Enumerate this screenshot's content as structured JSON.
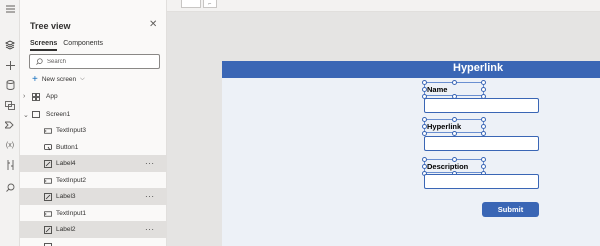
{
  "tree_panel": {
    "title": "Tree view",
    "tabs": [
      "Screens",
      "Components"
    ],
    "search_placeholder": "Search",
    "new_screen_label": "New screen",
    "items": [
      {
        "label": "App",
        "icon": "app-icon"
      },
      {
        "label": "Screen1",
        "icon": "screen-icon"
      },
      {
        "label": "TextInput3",
        "icon": "textinput-icon"
      },
      {
        "label": "Button1",
        "icon": "button-icon"
      },
      {
        "label": "Label4",
        "icon": "label-icon",
        "selected": true
      },
      {
        "label": "TextInput2",
        "icon": "textinput-icon"
      },
      {
        "label": "Label3",
        "icon": "label-icon",
        "selected": true
      },
      {
        "label": "TextInput1",
        "icon": "textinput-icon"
      },
      {
        "label": "Label2",
        "icon": "label-icon",
        "selected": true
      }
    ]
  },
  "rail": {
    "icons": [
      "hamburger-icon",
      "layers-icon",
      "insert-icon",
      "data-icon",
      "media-icon",
      "power-automate-icon",
      "variables-icon",
      "advanced-tools-icon",
      "search-icon"
    ],
    "variables_label": "(x)"
  },
  "canvas": {
    "header_title": "Hyperlink",
    "labels": [
      "Name",
      "Hyperlink",
      "Description"
    ],
    "submit_label": "Submit",
    "colors": {
      "header": "#3a66b5",
      "screen_bg": "#edf1f7",
      "button": "#3a66b5"
    }
  }
}
